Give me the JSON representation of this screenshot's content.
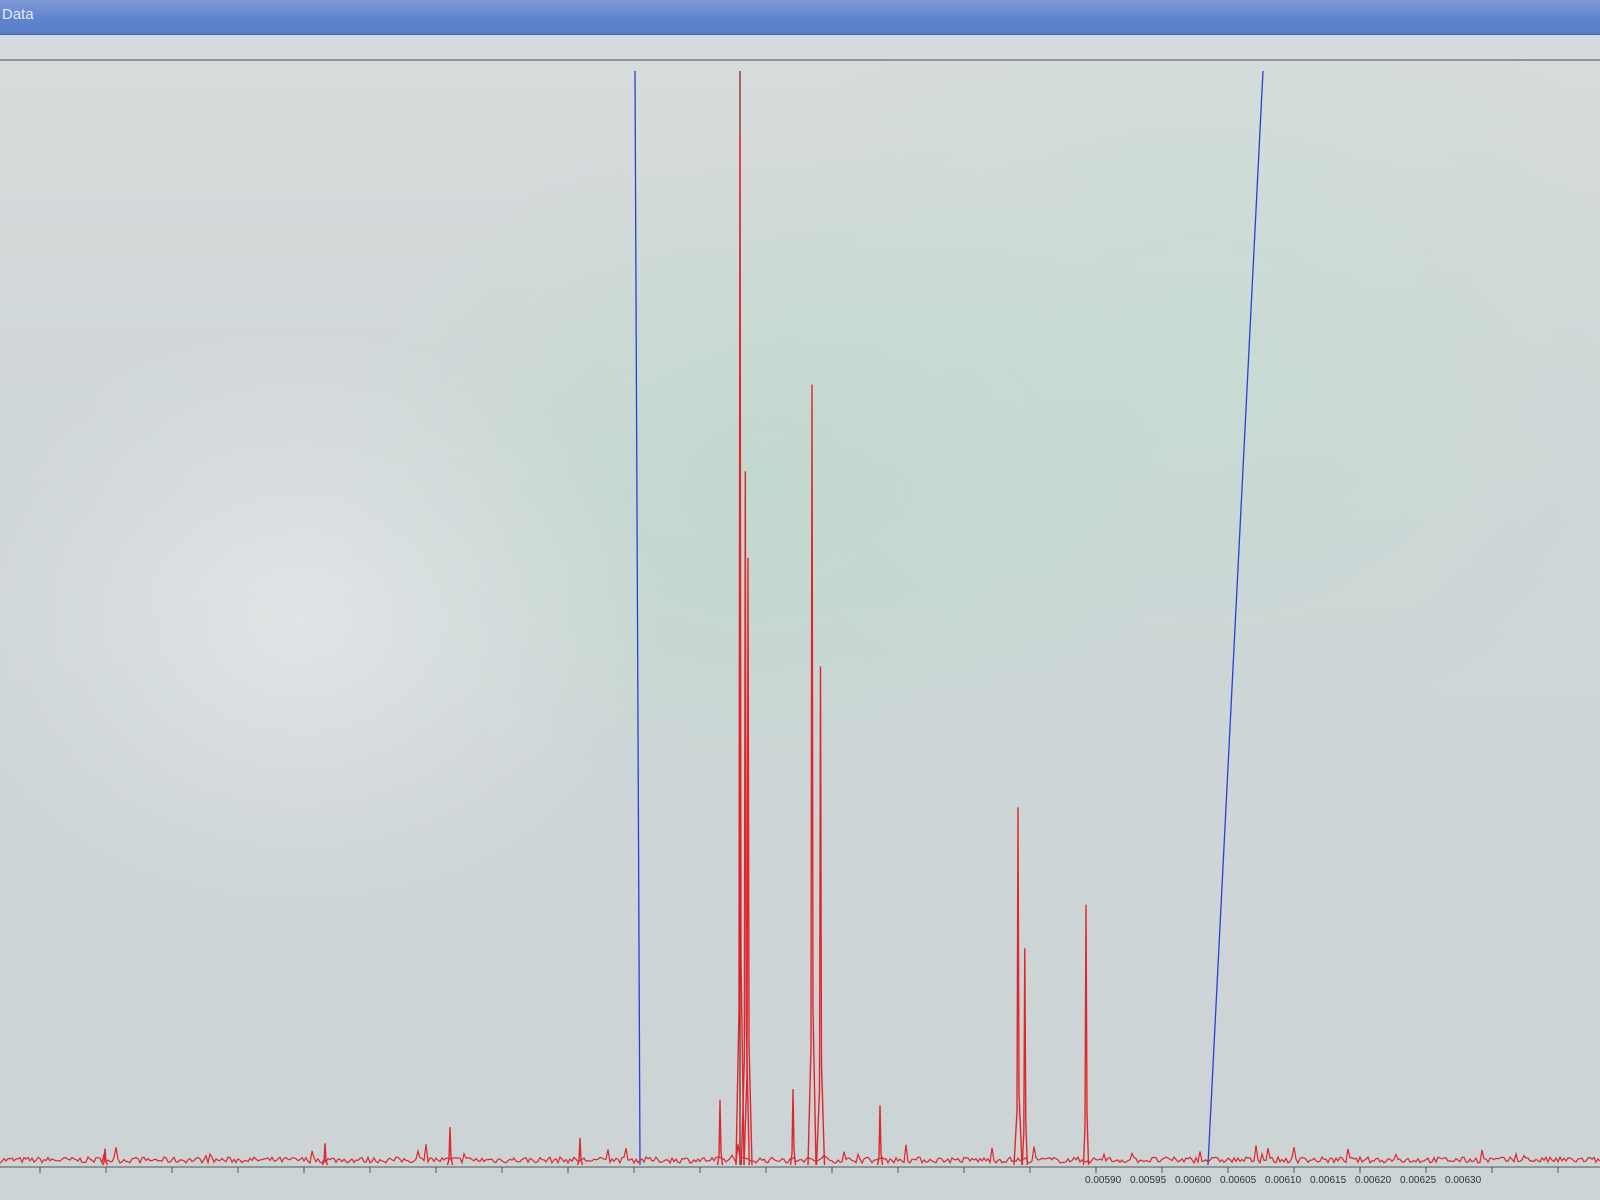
{
  "window": {
    "title": "Data"
  },
  "colors": {
    "spectrum": "#e0262b",
    "marker_line": "#2b3fd6",
    "titlebar": "#5f83cf"
  },
  "chart_data": {
    "type": "line",
    "title": "",
    "xlabel": "",
    "ylabel": "",
    "grid": false,
    "x_ticks_visible": [
      "0.00590",
      "0.00595",
      "0.00600",
      "0.00605",
      "0.00610",
      "0.00615",
      "0.00620",
      "0.00625",
      "0.00630"
    ],
    "xlim": [
      0.0054,
      0.00635
    ],
    "ylim": [
      0,
      1
    ],
    "series": [
      {
        "color": "#e0262b",
        "peaks": [
          {
            "x": 0.005435,
            "y": 0.015
          },
          {
            "x": 0.00556,
            "y": 0.02
          },
          {
            "x": 0.005705,
            "y": 0.035
          },
          {
            "x": 0.005815,
            "y": 0.025
          },
          {
            "x": 0.00604,
            "y": 0.06
          },
          {
            "x": 0.006085,
            "y": 0.95
          },
          {
            "x": 0.006095,
            "y": 0.64
          },
          {
            "x": 0.0061,
            "y": 0.56
          },
          {
            "x": 0.00615,
            "y": 0.07
          },
          {
            "x": 0.00617,
            "y": 0.72
          },
          {
            "x": 0.006175,
            "y": 0.46
          },
          {
            "x": 0.00621,
            "y": 0.055
          },
          {
            "x": 0.00629,
            "y": 0.33
          },
          {
            "x": 0.006295,
            "y": 0.2
          },
          {
            "x": 0.00634,
            "y": 0.24
          }
        ]
      }
    ],
    "markers": [
      {
        "x": 0.00599,
        "color": "#2b3fd6"
      },
      {
        "x": 0.006085,
        "color": "#8a2a20"
      },
      {
        "x": 0.00645,
        "color": "#2b3fd6"
      }
    ]
  }
}
